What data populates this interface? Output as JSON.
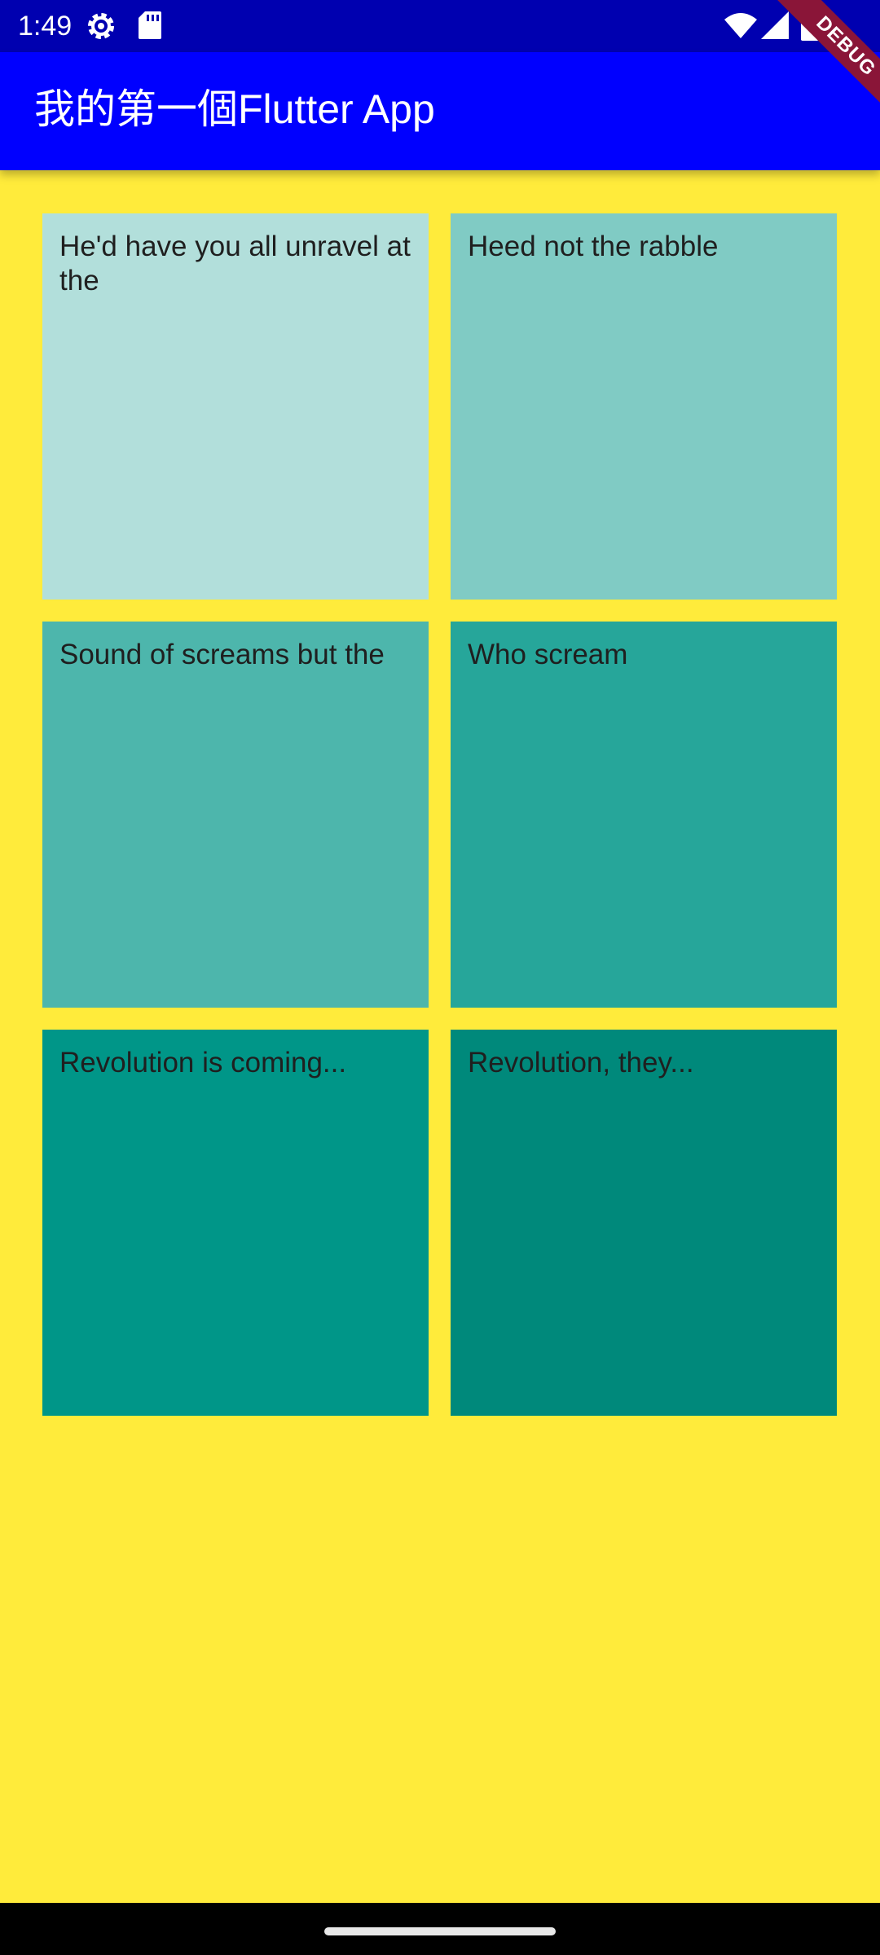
{
  "status_bar": {
    "time": "1:49",
    "icons": [
      "gear-icon",
      "sd-card-icon",
      "wifi-icon",
      "signal-icon",
      "battery-icon"
    ]
  },
  "app_bar": {
    "title_cjk": "我的第一個",
    "title_latin": "Flutter App",
    "color": "#0000ff"
  },
  "debug_banner": {
    "label": "DEBUG",
    "color": "#8a1538"
  },
  "background_color": "#ffeb3b",
  "tiles": [
    {
      "text": "He'd have you all unravel at the",
      "color": "#b2dfdb"
    },
    {
      "text": "Heed not the rabble",
      "color": "#80cbc4"
    },
    {
      "text": "Sound of screams but the",
      "color": "#4db6ac"
    },
    {
      "text": "Who scream",
      "color": "#26a69a"
    },
    {
      "text": "Revolution is coming...",
      "color": "#009688"
    },
    {
      "text": "Revolution, they...",
      "color": "#00897b"
    }
  ]
}
